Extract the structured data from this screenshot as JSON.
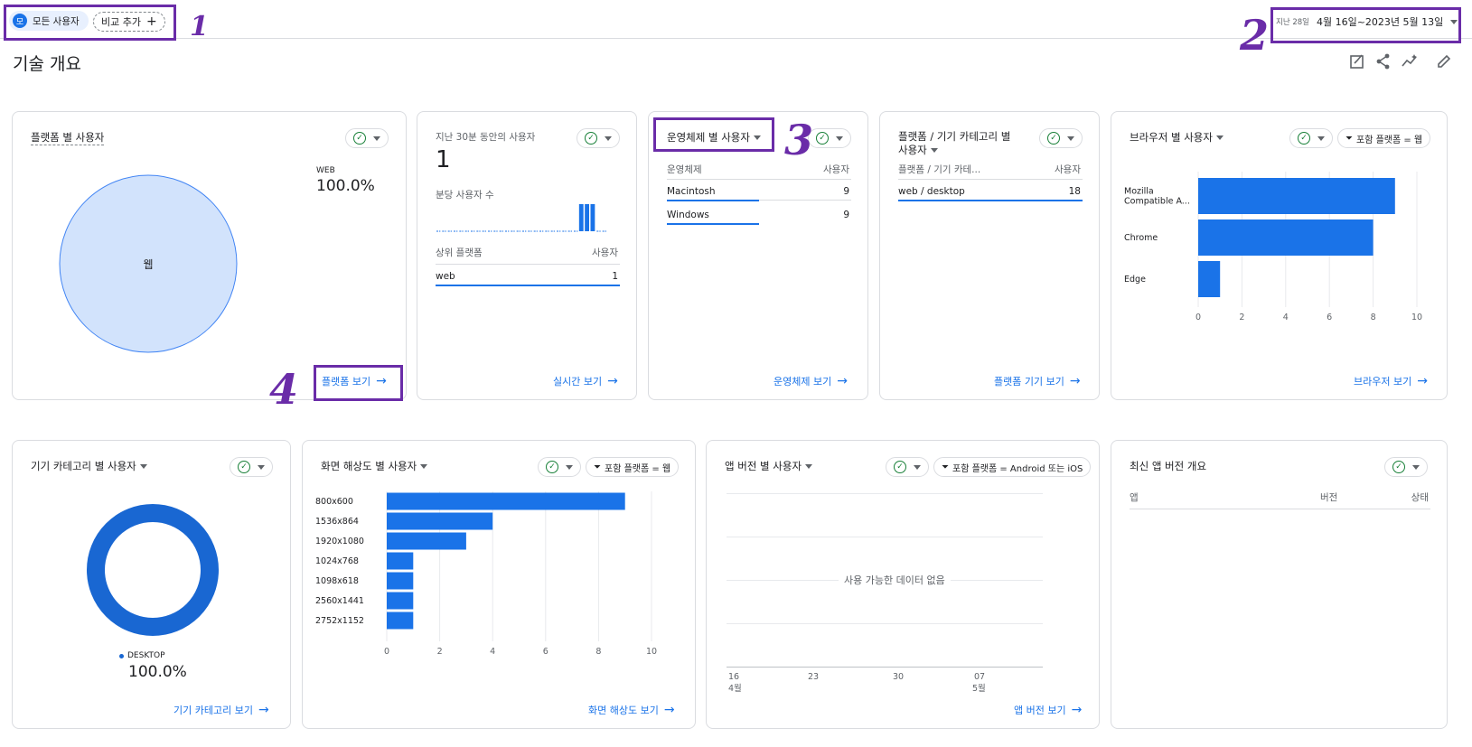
{
  "header": {
    "segment_avatar": "모",
    "segment_label": "모든 사용자",
    "compare_label": "비교 추가",
    "date_prefix": "지난 28일",
    "date_range": "4월 16일~2023년 5월 13일",
    "page_title": "기술 개요"
  },
  "annotations": [
    "1",
    "2",
    "3",
    "4"
  ],
  "platform_card": {
    "title": "플랫폼 별 사용자",
    "legend_label": "WEB",
    "legend_value": "100.0%",
    "pie_label": "웹",
    "link": "플랫폼 보기",
    "pie_color": "#d2e3fc"
  },
  "realtime_card": {
    "title": "지난 30분 동안의 사용자",
    "count": "1",
    "per_minute_label": "분당 사용자 수",
    "table_header_left": "상위 플랫폼",
    "table_header_right": "사용자",
    "rows": [
      {
        "name": "web",
        "value": "1"
      }
    ],
    "link": "실시간 보기",
    "minute_bars": [
      0,
      0,
      0,
      0,
      0,
      0,
      0,
      0,
      0,
      0,
      0,
      0,
      0,
      0,
      0,
      0,
      0,
      0,
      0,
      0,
      0,
      0,
      0,
      0,
      0,
      1,
      1,
      1,
      0,
      0
    ]
  },
  "os_card": {
    "title": "운영체제 별 사용자",
    "table_header_left": "운영체제",
    "table_header_right": "사용자",
    "rows": [
      {
        "name": "Macintosh",
        "value": "9"
      },
      {
        "name": "Windows",
        "value": "9"
      }
    ],
    "link": "운영체제 보기"
  },
  "device_card": {
    "title_line1": "플랫폼 / 기기 카테고리 별",
    "title_line2": "사용자",
    "table_header_left": "플랫폼 / 기기 카테...",
    "table_header_right": "사용자",
    "rows": [
      {
        "name": "web / desktop",
        "value": "18"
      }
    ],
    "link": "플랫폼 기기 보기"
  },
  "browser_card": {
    "title": "브라우저 별 사용자",
    "filter": "포함 플랫폼 = 웹",
    "link": "브라우저 보기"
  },
  "category_card": {
    "title": "기기 카테고리 별 사용자",
    "legend_label": "DESKTOP",
    "legend_value": "100.0%",
    "link": "기기 카테고리 보기",
    "donut_color": "#1967d2"
  },
  "resolution_card": {
    "title": "화면 해상도 별 사용자",
    "filter": "포함 플랫폼 = 웹",
    "link": "화면 해상도 보기"
  },
  "appversion_card": {
    "title": "앱 버전 별 사용자",
    "filter": "포함 플랫폼 = Android 또는 iOS",
    "no_data": "사용 가능한 데이터 없음",
    "x_ticks": [
      "16",
      "23",
      "30",
      "07"
    ],
    "x_months": [
      "4월",
      "5월"
    ],
    "link": "앱 버전 보기"
  },
  "latest_card": {
    "title": "최신 앱 버전 개요",
    "col1": "앱",
    "col2": "버전",
    "col3": "상태"
  },
  "chart_data": [
    {
      "type": "bar",
      "orientation": "horizontal",
      "title": "브라우저 별 사용자",
      "categories": [
        "Mozilla Compatible A...",
        "Chrome",
        "Edge"
      ],
      "values": [
        9,
        8,
        1
      ],
      "xlim": [
        0,
        10
      ],
      "x_ticks": [
        "0",
        "2",
        "4",
        "6",
        "8",
        "10"
      ],
      "color": "#1a73e8"
    },
    {
      "type": "bar",
      "orientation": "horizontal",
      "title": "화면 해상도 별 사용자",
      "categories": [
        "800x600",
        "1536x864",
        "1920x1080",
        "1024x768",
        "1098x618",
        "2560x1441",
        "2752x1152"
      ],
      "values": [
        9,
        4,
        3,
        1,
        1,
        1,
        1
      ],
      "xlim": [
        0,
        10
      ],
      "x_ticks": [
        "0",
        "2",
        "4",
        "6",
        "8",
        "10"
      ],
      "color": "#1a73e8"
    }
  ]
}
